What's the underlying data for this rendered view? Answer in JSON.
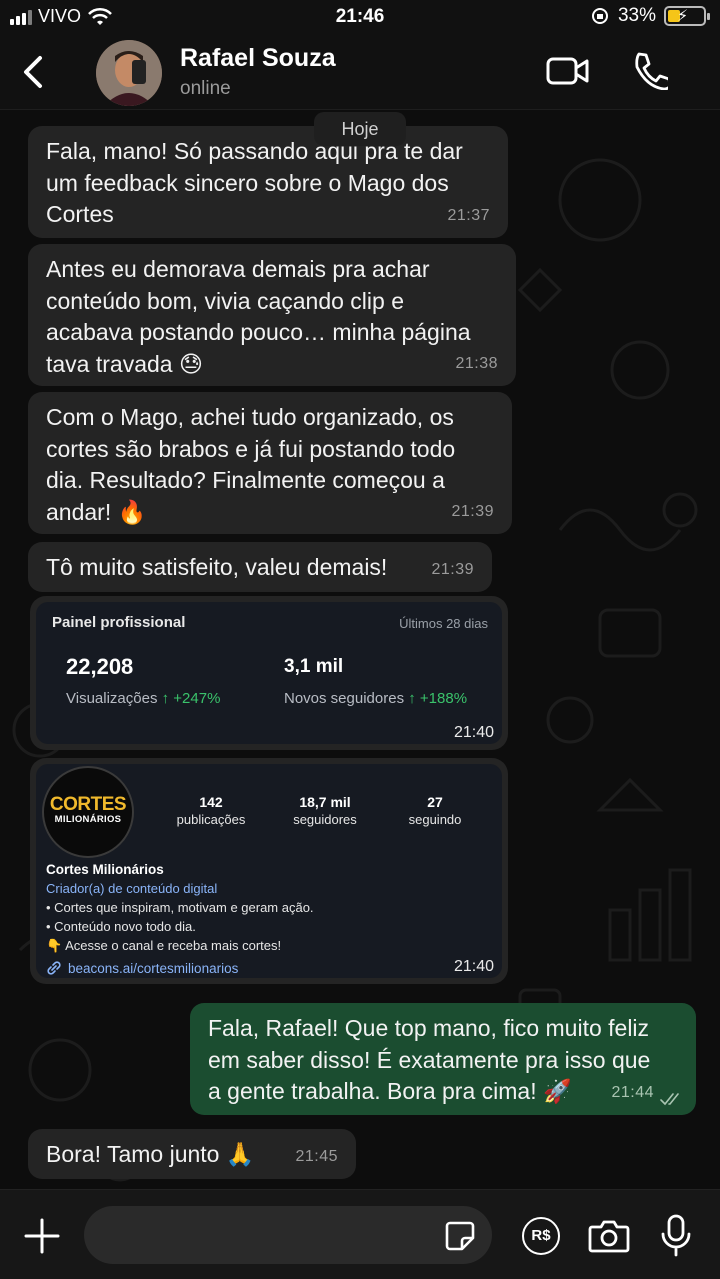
{
  "status_bar": {
    "carrier": "VIVO",
    "time": "21:46",
    "battery": "33%"
  },
  "header": {
    "contact_name": "Rafael Souza",
    "contact_status": "online"
  },
  "chat": {
    "day_label": "Hoje",
    "messages": [
      {
        "lines": [
          "Fala, mano! Só passando aqui pra te dar",
          "um feedback sincero sobre o Mago dos",
          "Cortes"
        ],
        "time": "21:37"
      },
      {
        "lines": [
          "Antes eu demorava demais pra achar",
          "conteúdo bom, vivia caçando clip e",
          "acabava postando pouco… minha página",
          "tava travada 😓"
        ],
        "time": "21:38"
      },
      {
        "lines": [
          "Com o Mago, achei tudo organizado, os",
          "cortes são brabos e já fui postando todo",
          "dia. Resultado? Finalmente começou a",
          "andar! 🔥"
        ],
        "time": "21:39"
      },
      {
        "lines": [
          "Tô muito satisfeito, valeu demais!"
        ],
        "time": "21:39"
      }
    ],
    "dashboard_card": {
      "title": "Painel profissional",
      "period": "Últimos 28 dias",
      "views_value": "22,208",
      "views_label": "Visualizações",
      "views_change": "↑ +247%",
      "followers_value": "3,1 mil",
      "followers_label": "Novos seguidores",
      "followers_change": "↑ +188%",
      "time": "21:40"
    },
    "profile_card": {
      "logo_top": "CORTES",
      "logo_bottom": "MILIONÁRIOS",
      "posts_value": "142",
      "posts_label": "publicações",
      "followers_value": "18,7 mil",
      "followers_label": "seguidores",
      "following_value": "27",
      "following_label": "seguindo",
      "name": "Cortes Milionários",
      "category": "Criador(a) de conteúdo digital",
      "bio_1": "• Cortes que inspiram, motivam e geram ação.",
      "bio_2": "• Conteúdo novo todo dia.",
      "bio_3": "👇 Acesse o canal e receba mais cortes!",
      "link": "beacons.ai/cortesmilionarios",
      "time": "21:40"
    },
    "outgoing": {
      "lines": [
        "Fala, Rafael! Que top mano, fico muito feliz",
        "em saber disso! É exatamente pra isso que",
        "a gente trabalha. Bora pra cima! 🚀"
      ],
      "time": "21:44"
    },
    "last_incoming": {
      "text": "Bora! Tamo junto 🙏",
      "time": "21:45"
    }
  },
  "composer": {
    "input_value": "",
    "pay_label": "R$"
  },
  "colors": {
    "incoming_bubble": "#242424",
    "outgoing_bubble": "#1b4d30",
    "accent_green": "#3ac26b",
    "link_blue": "#8ab4f8"
  }
}
